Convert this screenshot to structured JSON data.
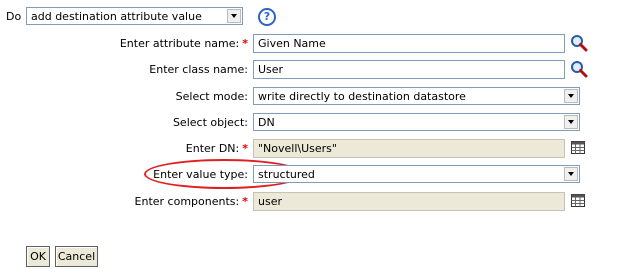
{
  "header": {
    "do_label": "Do",
    "action_select": {
      "value": "add destination attribute value"
    },
    "help_icon": "?"
  },
  "form": {
    "attribute_name": {
      "label": "Enter attribute name:",
      "required": true,
      "value": "Given Name",
      "icon": "search-icon"
    },
    "class_name": {
      "label": "Enter class name:",
      "required": false,
      "value": "User",
      "icon": "search-icon"
    },
    "select_mode": {
      "label": "Select mode:",
      "value": "write directly to destination datastore"
    },
    "select_object": {
      "label": "Select object:",
      "value": "DN"
    },
    "dn": {
      "label": "Enter DN:",
      "required": true,
      "value": "\"Novell\\Users\"",
      "icon": "calendar-builder-icon"
    },
    "value_type": {
      "label": "Enter value type:",
      "value": "structured",
      "highlighted": true
    },
    "components": {
      "label": "Enter components:",
      "required": true,
      "value": "user",
      "icon": "calendar-builder-icon"
    }
  },
  "footer": {
    "ok_label": "OK",
    "cancel_label": "Cancel"
  },
  "colors": {
    "required_marker": "#e00000",
    "highlight": "#e02020",
    "readonly_field": "#ece9d8",
    "help_icon": "#2e63c9"
  }
}
